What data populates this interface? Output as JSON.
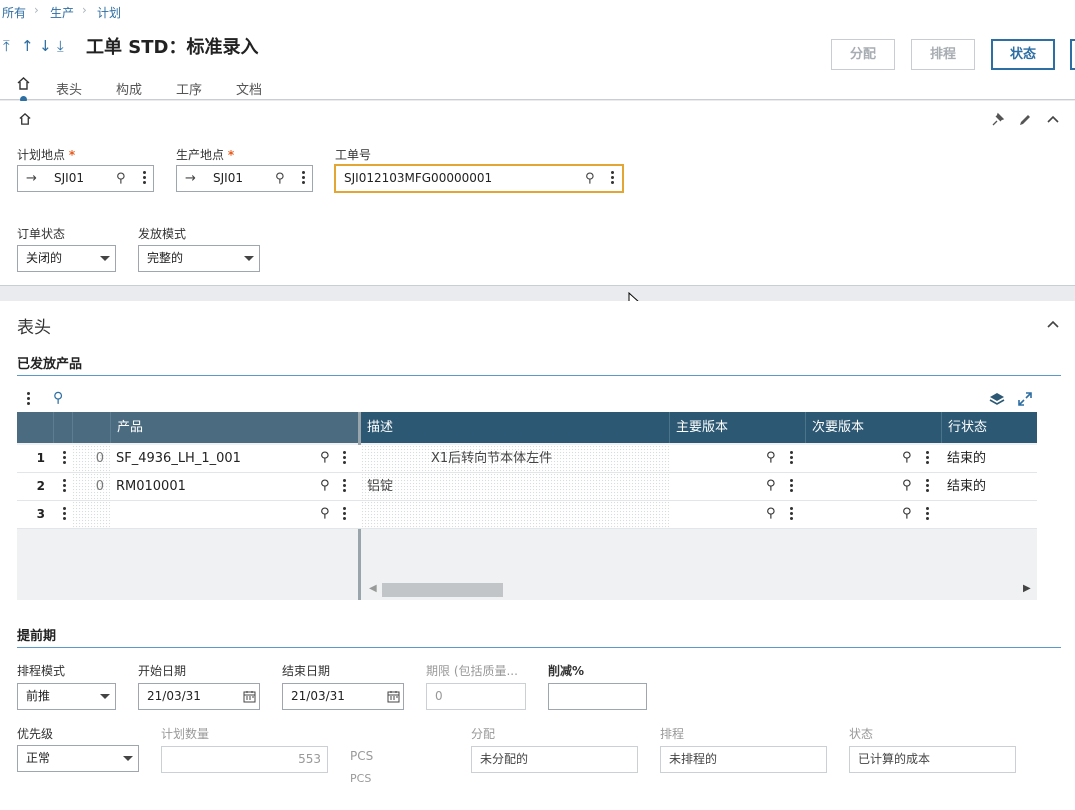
{
  "breadcrumb": {
    "items": [
      "所有",
      "生产",
      "计划"
    ]
  },
  "nav_arrows": [
    "⤒",
    "↑",
    "↓",
    "⤓"
  ],
  "page_title": "工单 STD：标准录入",
  "actions": {
    "allocate": "分配",
    "schedule": "排程",
    "status": "状态"
  },
  "tabs": [
    "表头",
    "构成",
    "工序",
    "文档"
  ],
  "top_panel": {
    "plan_site": {
      "label": "计划地点",
      "value": "SJI01"
    },
    "prod_site": {
      "label": "生产地点",
      "value": "SJI01"
    },
    "work_order": {
      "label": "工单号",
      "value": "SJI012103MFG00000001"
    },
    "order_status": {
      "label": "订单状态",
      "value": "关闭的"
    },
    "release_mode": {
      "label": "发放模式",
      "value": "完整的"
    }
  },
  "header_section": {
    "title": "表头",
    "released_products": "已发放产品",
    "grid": {
      "columns": [
        "产品",
        "描述",
        "主要版本",
        "次要版本",
        "行状态"
      ],
      "rows": [
        {
          "num": "1",
          "qty": "0",
          "product": "SF_4936_LH_1_001",
          "desc": "X1后转向节本体左件",
          "status": "结束的"
        },
        {
          "num": "2",
          "qty": "0",
          "product": "RM010001",
          "desc": "铝锭",
          "status": "结束的"
        },
        {
          "num": "3",
          "qty": "",
          "product": "",
          "desc": "",
          "status": ""
        }
      ]
    },
    "lead_time": {
      "title": "提前期",
      "sched_mode": {
        "label": "排程模式",
        "value": "前推"
      },
      "start_date": {
        "label": "开始日期",
        "value": "21/03/31"
      },
      "end_date": {
        "label": "结束日期",
        "value": "21/03/31"
      },
      "period": {
        "label": "期限 (包括质量...",
        "value": "0"
      },
      "reduction": {
        "label": "削减%",
        "value": ""
      },
      "priority": {
        "label": "优先级",
        "value": "正常"
      },
      "plan_qty": {
        "label": "计划数量",
        "value": "553",
        "unit": "PCS",
        "unit2": "PCS"
      },
      "allocation": {
        "label": "分配",
        "value": "未分配的"
      },
      "scheduling": {
        "label": "排程",
        "value": "未排程的"
      },
      "status": {
        "label": "状态",
        "value": "已计算的成本"
      }
    }
  },
  "icons": {
    "home": "home-icon",
    "search": "search-icon",
    "pin": "pin-icon",
    "edit": "pencil-icon",
    "collapse": "chevron-up-icon",
    "calendar": "calendar-icon",
    "arrow": "arrow-right-icon",
    "layers": "layers-icon",
    "expand": "expand-icon"
  },
  "colors": {
    "accent": "#2d6ea3",
    "grid_header": "#2c5873",
    "focus": "#e3a534",
    "required": "#e65b1d"
  }
}
